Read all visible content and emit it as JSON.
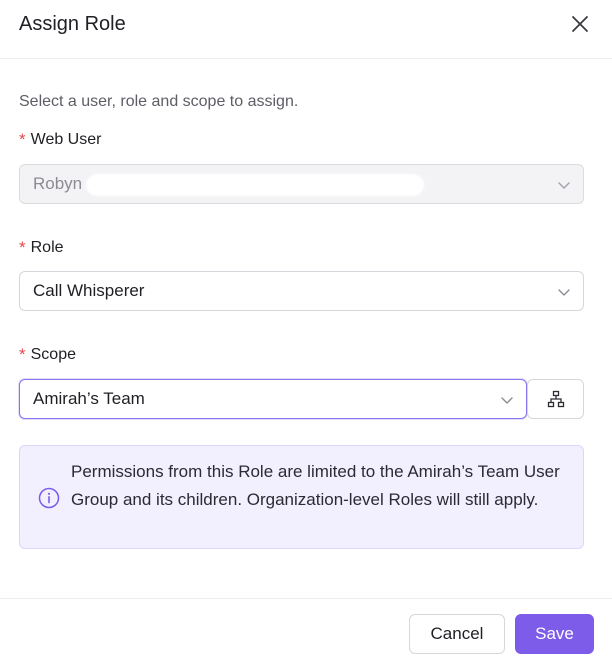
{
  "dialog": {
    "title": "Assign Role",
    "subtitle": "Select a user, role and scope to assign."
  },
  "fields": {
    "web_user": {
      "label": "Web User",
      "required_mark": "*",
      "value": "Robyn"
    },
    "role": {
      "label": "Role",
      "required_mark": "*",
      "value": "Call Whisperer"
    },
    "scope": {
      "label": "Scope",
      "required_mark": "*",
      "value": "Amirah’s Team"
    }
  },
  "info": {
    "text": "Permissions from this Role are limited to the Amirah’s Team User Group and its children. Organization-level Roles will still apply."
  },
  "footer": {
    "cancel_label": "Cancel",
    "save_label": "Save"
  },
  "icons": {
    "close": "close-icon",
    "chevron": "chevron-down-icon",
    "hierarchy": "hierarchy-tree-icon",
    "info": "info-icon"
  },
  "colors": {
    "accent": "#7c5ce8",
    "required": "#e5484d",
    "info_bg": "#f2effe"
  }
}
